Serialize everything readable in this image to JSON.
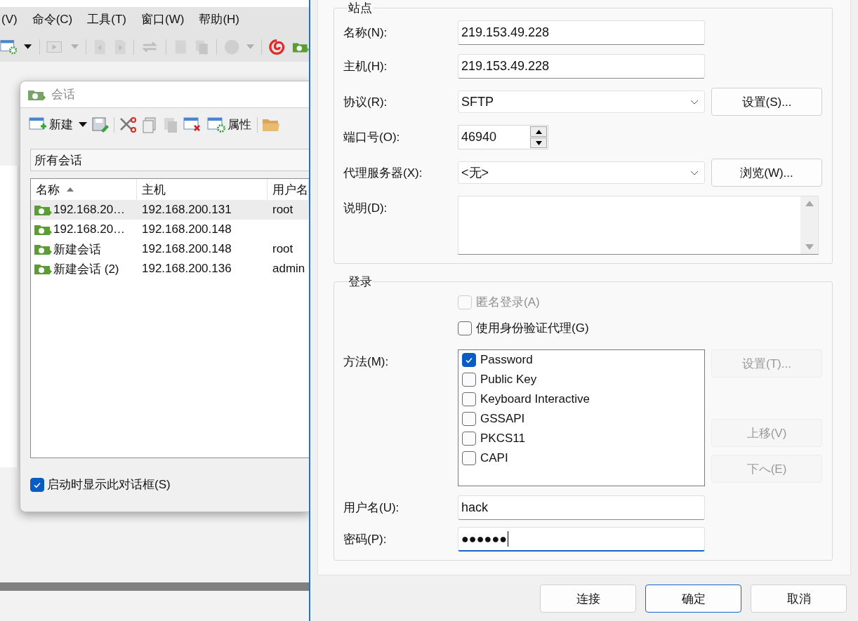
{
  "app_menu": [
    "(V)",
    "命令(C)",
    "工具(T)",
    "窗口(W)",
    "帮助(H)"
  ],
  "sessions_dialog": {
    "title": "会话",
    "toolbar": [
      {
        "kind": "new",
        "label": "新建"
      },
      {
        "kind": "dropdown"
      },
      {
        "kind": "save"
      },
      {
        "kind": "sep"
      },
      {
        "kind": "cut"
      },
      {
        "kind": "copy"
      },
      {
        "kind": "paste"
      },
      {
        "kind": "delete"
      },
      {
        "kind": "properties",
        "label": "属性"
      },
      {
        "kind": "sep"
      },
      {
        "kind": "folder"
      }
    ],
    "folder": "所有会话",
    "columns": [
      {
        "label": "名称",
        "sorted": true
      },
      {
        "label": "主机",
        "sorted": false
      },
      {
        "label": "用户名",
        "sorted": false
      }
    ],
    "rows": [
      {
        "name": "192.168.20…",
        "host": "192.168.200.131",
        "user": "root",
        "selected": true
      },
      {
        "name": "192.168.20…",
        "host": "192.168.200.148",
        "user": "",
        "selected": false
      },
      {
        "name": "新建会话",
        "host": "192.168.200.148",
        "user": "root",
        "selected": false
      },
      {
        "name": "新建会话 (2)",
        "host": "192.168.200.136",
        "user": "admin",
        "selected": false
      }
    ],
    "show_on_startup": {
      "label": "启动时显示此对话框(S)",
      "checked": true
    }
  },
  "site_dialog": {
    "site_group": {
      "title": "站点",
      "name": {
        "label": "名称(N):",
        "value": "219.153.49.228"
      },
      "host": {
        "label": "主机(H):",
        "value": "219.153.49.228"
      },
      "protocol": {
        "label": "协议(R):",
        "value": "SFTP",
        "button": "设置(S)..."
      },
      "port": {
        "label": "端口号(O):",
        "value": "46940"
      },
      "proxy": {
        "label": "代理服务器(X):",
        "value": "<无>",
        "button": "浏览(W)..."
      },
      "description": {
        "label": "说明(D):"
      }
    },
    "login_group": {
      "title": "登录",
      "anonymous": {
        "label": "匿名登录(A)",
        "checked": false,
        "disabled": true
      },
      "agent": {
        "label": "使用身份验证代理(G)",
        "checked": false,
        "disabled": false
      },
      "method_label": "方法(M):",
      "methods": [
        {
          "label": "Password",
          "checked": true
        },
        {
          "label": "Public Key",
          "checked": false
        },
        {
          "label": "Keyboard Interactive",
          "checked": false
        },
        {
          "label": "GSSAPI",
          "checked": false
        },
        {
          "label": "PKCS11",
          "checked": false
        },
        {
          "label": "CAPI",
          "checked": false
        }
      ],
      "method_buttons": [
        {
          "label": "设置(T)...",
          "disabled": true
        },
        {
          "label": "上移(V)",
          "disabled": true
        },
        {
          "label": "下へ(E)",
          "disabled": true
        }
      ],
      "username": {
        "label": "用户名(U):",
        "value": "hack"
      },
      "password": {
        "label": "密码(P):",
        "value": "●●●●●●",
        "focused": true
      }
    },
    "buttons": [
      {
        "label": "连接",
        "default": false
      },
      {
        "label": "确定",
        "default": true
      },
      {
        "label": "取消",
        "default": false
      }
    ]
  }
}
